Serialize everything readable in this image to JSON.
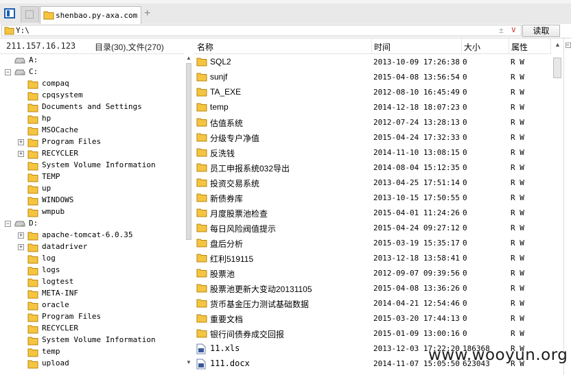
{
  "tabs": {
    "active_label": "shenbao.py-axa.com",
    "new_tab_symbol": "+"
  },
  "address": {
    "value": "Y:\\",
    "bookmark_symbol": "±",
    "dropdown_symbol": "∨",
    "read_button": "读取"
  },
  "status": {
    "ip": "211.157.16.123",
    "counts": "目录(30),文件(270)"
  },
  "tree": [
    {
      "depth": 0,
      "type": "drive",
      "label": "A:",
      "expander": ""
    },
    {
      "depth": 0,
      "type": "drive",
      "label": "C:",
      "expander": "−"
    },
    {
      "depth": 1,
      "type": "folder",
      "label": "compaq",
      "expander": ""
    },
    {
      "depth": 1,
      "type": "folder",
      "label": "cpqsystem",
      "expander": ""
    },
    {
      "depth": 1,
      "type": "folder",
      "label": "Documents and Settings",
      "expander": ""
    },
    {
      "depth": 1,
      "type": "folder",
      "label": "hp",
      "expander": ""
    },
    {
      "depth": 1,
      "type": "folder",
      "label": "MSOCache",
      "expander": ""
    },
    {
      "depth": 1,
      "type": "folder",
      "label": "Program Files",
      "expander": "+"
    },
    {
      "depth": 1,
      "type": "folder",
      "label": "RECYCLER",
      "expander": "+"
    },
    {
      "depth": 1,
      "type": "folder",
      "label": "System Volume Information",
      "expander": ""
    },
    {
      "depth": 1,
      "type": "folder",
      "label": "TEMP",
      "expander": ""
    },
    {
      "depth": 1,
      "type": "folder",
      "label": "up",
      "expander": ""
    },
    {
      "depth": 1,
      "type": "folder",
      "label": "WINDOWS",
      "expander": ""
    },
    {
      "depth": 1,
      "type": "folder",
      "label": "wmpub",
      "expander": ""
    },
    {
      "depth": 0,
      "type": "drive",
      "label": "D:",
      "expander": "−"
    },
    {
      "depth": 1,
      "type": "folder",
      "label": "apache-tomcat-6.0.35",
      "expander": "+"
    },
    {
      "depth": 1,
      "type": "folder",
      "label": "datadriver",
      "expander": "+"
    },
    {
      "depth": 1,
      "type": "folder",
      "label": "log",
      "expander": ""
    },
    {
      "depth": 1,
      "type": "folder",
      "label": "logs",
      "expander": ""
    },
    {
      "depth": 1,
      "type": "folder",
      "label": "logtest",
      "expander": ""
    },
    {
      "depth": 1,
      "type": "folder",
      "label": "META-INF",
      "expander": ""
    },
    {
      "depth": 1,
      "type": "folder",
      "label": "oracle",
      "expander": ""
    },
    {
      "depth": 1,
      "type": "folder",
      "label": "Program Files",
      "expander": ""
    },
    {
      "depth": 1,
      "type": "folder",
      "label": "RECYCLER",
      "expander": ""
    },
    {
      "depth": 1,
      "type": "folder",
      "label": "System Volume Information",
      "expander": ""
    },
    {
      "depth": 1,
      "type": "folder",
      "label": "temp",
      "expander": ""
    },
    {
      "depth": 1,
      "type": "folder",
      "label": "upload",
      "expander": ""
    }
  ],
  "columns": {
    "name": "名称",
    "time": "时间",
    "size": "大小",
    "attr": "属性"
  },
  "files": [
    {
      "type": "folder",
      "name": "SQL2",
      "time": "2013-10-09 17:26:38",
      "size": "0",
      "attr": "R W"
    },
    {
      "type": "folder",
      "name": "sunjf",
      "time": "2015-04-08 13:56:54",
      "size": "0",
      "attr": "R W"
    },
    {
      "type": "folder",
      "name": "TA_EXE",
      "time": "2012-08-10 16:45:49",
      "size": "0",
      "attr": "R W"
    },
    {
      "type": "folder",
      "name": "temp",
      "time": "2014-12-18 18:07:23",
      "size": "0",
      "attr": "R W"
    },
    {
      "type": "folder",
      "name": "估值系统",
      "time": "2012-07-24 13:28:13",
      "size": "0",
      "attr": "R W"
    },
    {
      "type": "folder",
      "name": "分级专户净值",
      "time": "2015-04-24 17:32:33",
      "size": "0",
      "attr": "R W"
    },
    {
      "type": "folder",
      "name": "反洗钱",
      "time": "2014-11-10 13:08:15",
      "size": "0",
      "attr": "R W"
    },
    {
      "type": "folder",
      "name": "员工申报系统032导出",
      "time": "2014-08-04 15:12:35",
      "size": "0",
      "attr": "R W"
    },
    {
      "type": "folder",
      "name": "投资交易系统",
      "time": "2013-04-25 17:51:14",
      "size": "0",
      "attr": "R W"
    },
    {
      "type": "folder",
      "name": "新债券库",
      "time": "2013-10-15 17:50:55",
      "size": "0",
      "attr": "R W"
    },
    {
      "type": "folder",
      "name": "月度股票池检查",
      "time": "2015-04-01 11:24:26",
      "size": "0",
      "attr": "R W"
    },
    {
      "type": "folder",
      "name": "每日风险阀值提示",
      "time": "2015-04-24 09:27:12",
      "size": "0",
      "attr": "R W"
    },
    {
      "type": "folder",
      "name": "盘后分析",
      "time": "2015-03-19 15:35:17",
      "size": "0",
      "attr": "R W"
    },
    {
      "type": "folder",
      "name": "红利519115",
      "time": "2013-12-18 13:58:41",
      "size": "0",
      "attr": "R W"
    },
    {
      "type": "folder",
      "name": "股票池",
      "time": "2012-09-07 09:39:56",
      "size": "0",
      "attr": "R W"
    },
    {
      "type": "folder",
      "name": "股票池更新大变动20131105",
      "time": "2015-04-08 13:36:26",
      "size": "0",
      "attr": "R W"
    },
    {
      "type": "folder",
      "name": "货币基金压力测试基础数据",
      "time": "2014-04-21 12:54:46",
      "size": "0",
      "attr": "R W"
    },
    {
      "type": "folder",
      "name": "重要文档",
      "time": "2015-03-20 17:44:13",
      "size": "0",
      "attr": "R W"
    },
    {
      "type": "folder",
      "name": "银行间债券成交回报",
      "time": "2015-01-09 13:00:16",
      "size": "0",
      "attr": "R W"
    },
    {
      "type": "file",
      "name": "11.xls",
      "time": "2013-12-03 17:22:20",
      "size": "186368",
      "attr": "R W"
    },
    {
      "type": "file",
      "name": "111.docx",
      "time": "2014-11-07 15:05:50",
      "size": "623043",
      "attr": "R W"
    }
  ],
  "watermark": "www.wooyun.org",
  "colors": {
    "folder": "#f5c542",
    "accent": "#1a5fb4"
  }
}
